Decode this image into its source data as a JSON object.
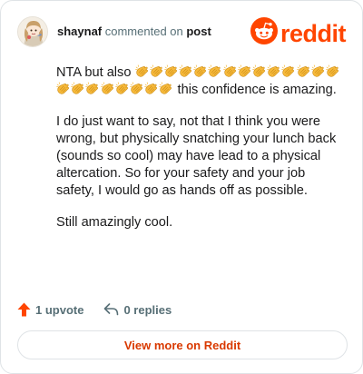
{
  "header": {
    "username": "shaynaf",
    "action": " commented on ",
    "post_link": "post",
    "brand": "reddit"
  },
  "comment": {
    "line1_before": "NTA but also ",
    "clap_emoji_count": 22,
    "line1_after": " this confidence is amazing.",
    "paragraph2": "I do just want to say, not that I think you were wrong, but physically snatching your lunch back (sounds so cool) may have lead to a physical altercation. So for your safety and your job safety, I would go as hands off as possible.",
    "paragraph3": "Still amazingly cool."
  },
  "footer": {
    "upvote_label": "1 upvote",
    "replies_label": "0 replies"
  },
  "cta": {
    "view_more": "View more on Reddit"
  },
  "colors": {
    "brand": "#ff4500",
    "upvote": "#ff4500",
    "link": "#d93900",
    "muted": "#576f76"
  },
  "icons": {
    "upvote": "upvote-arrow-icon",
    "reply": "reply-arrow-icon",
    "brand": "reddit-snoo-icon",
    "emoji": "clapping-hands-emoji"
  }
}
